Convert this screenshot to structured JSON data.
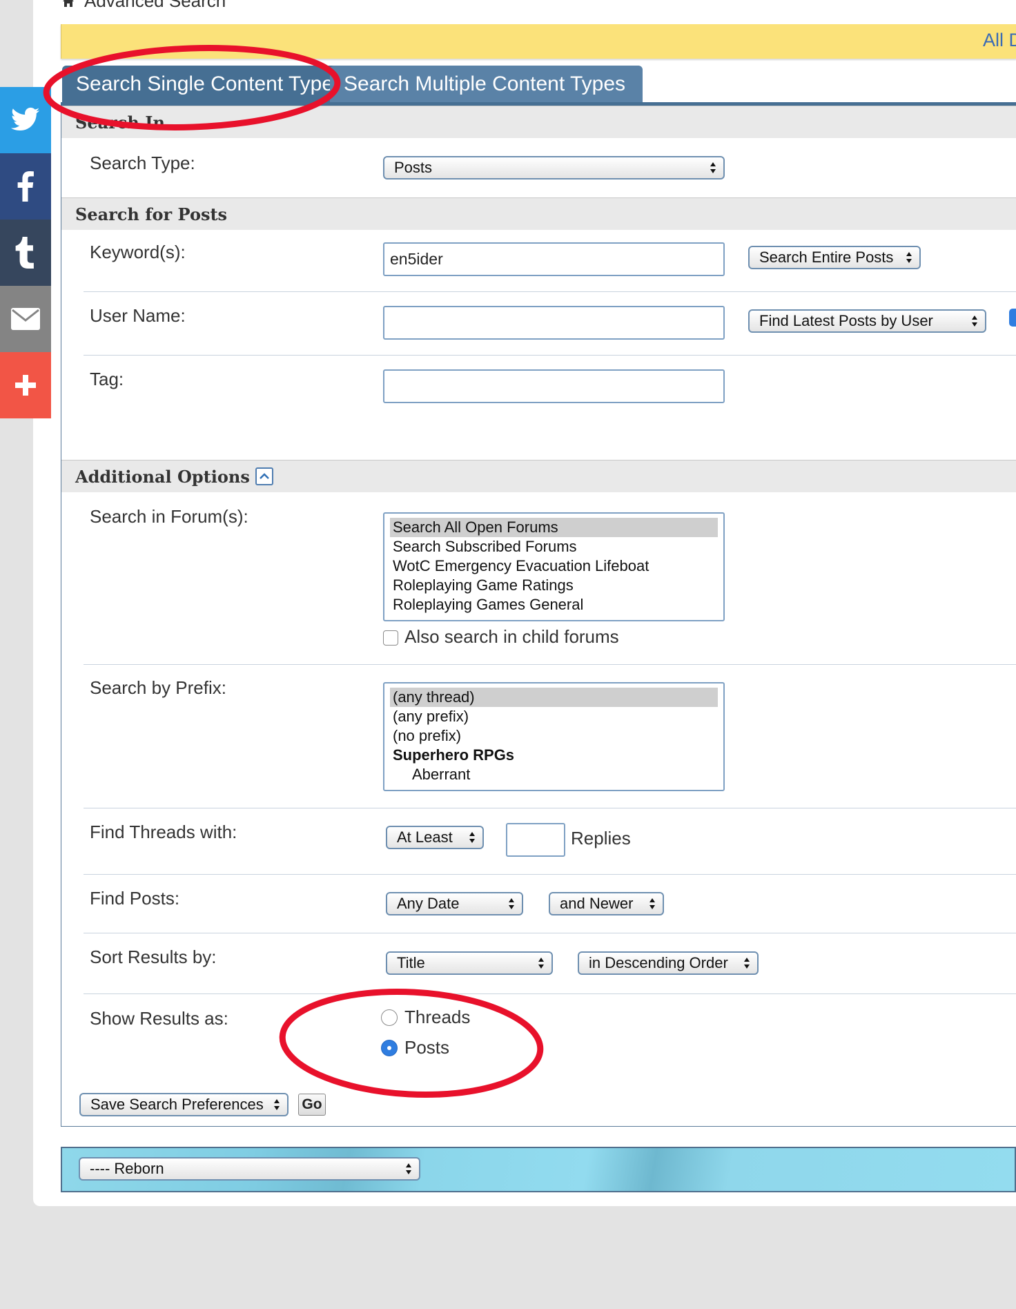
{
  "breadcrumb": {
    "current": "Advanced Search"
  },
  "notice": {
    "link_text": "All Di"
  },
  "tabs": [
    {
      "label": "Search Single Content Type"
    },
    {
      "label": "Search Multiple Content Types"
    }
  ],
  "search_in": {
    "header": "Search In",
    "type_label": "Search Type:",
    "type_value": "Posts"
  },
  "search_for_posts": {
    "header": "Search for Posts",
    "keywords_label": "Keyword(s):",
    "keywords_value": "en5ider",
    "keyword_scope": "Search Entire Posts",
    "username_label": "User Name:",
    "username_value": "",
    "user_mode": "Find Latest Posts by User",
    "tag_label": "Tag:",
    "tag_value": ""
  },
  "additional_options": {
    "header": "Additional Options",
    "forums_label": "Search in Forum(s):",
    "forums": [
      "Search All Open Forums",
      "Search Subscribed Forums",
      "WotC Emergency Evacuation Lifeboat",
      "Roleplaying Game Ratings",
      "Roleplaying Games General"
    ],
    "child_forums_label": "Also search in child forums",
    "prefix_label": "Search by Prefix:",
    "prefixes": [
      "(any thread)",
      "(any prefix)",
      "(no prefix)",
      "Superhero RPGs",
      "Aberrant"
    ],
    "threads_label": "Find Threads with:",
    "threads_compare": "At Least",
    "threads_count": "",
    "replies_label": "Replies",
    "posts_label": "Find Posts:",
    "posts_date": "Any Date",
    "posts_direction": "and Newer",
    "sort_label": "Sort Results by:",
    "sort_field": "Title",
    "sort_order": "in Descending Order",
    "show_label": "Show Results as:",
    "show_threads": "Threads",
    "show_posts": "Posts"
  },
  "actions": {
    "save_prefs": "Save Search Preferences",
    "go": "Go"
  },
  "footer": {
    "style_select": "---- Reborn"
  },
  "colors": {
    "tab_active": "#466f93",
    "tab_inactive": "#5a82a7",
    "notice": "#fbe27a",
    "twitter": "#2b9ee5",
    "facebook": "#2f4b82",
    "tumblr": "#36465d",
    "email": "#848484",
    "more": "#f25546",
    "annotation": "#e8112b"
  },
  "icons": [
    "home-icon",
    "twitter-icon",
    "facebook-icon",
    "tumblr-icon",
    "email-icon",
    "plus-icon",
    "collapse-icon"
  ]
}
